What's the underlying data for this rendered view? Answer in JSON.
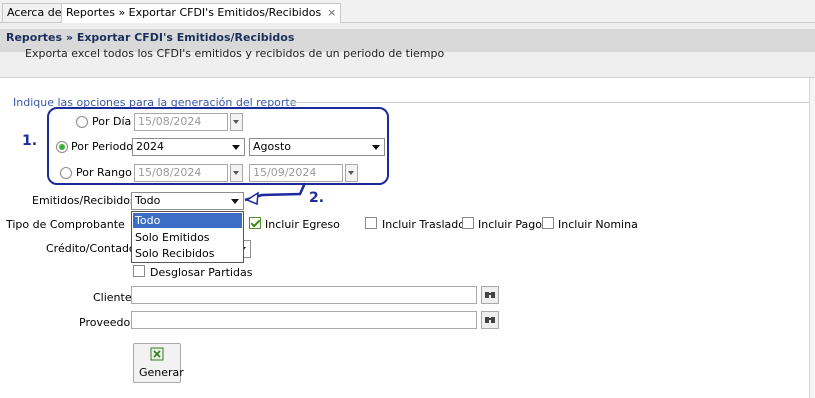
{
  "tabs": [
    {
      "label": "Acerca de"
    },
    {
      "label": "Reportes » Exportar CFDI's Emitidos/Recibidos",
      "close": "×"
    }
  ],
  "header": {
    "title": "Reportes » Exportar CFDI's Emitidos/Recibidos",
    "subtitle": "Exporta excel todos los CFDI's emitidos y recibidos de un periodo de tiempo"
  },
  "options": {
    "legend": "Indique las opciones para la generación del reporte",
    "por_dia": {
      "label": "Por Día",
      "value": "15/08/2024"
    },
    "por_periodo": {
      "label": "Por Periodo",
      "year": "2024",
      "month": "Agosto"
    },
    "por_rango": {
      "label": "Por Rango",
      "from": "15/08/2024",
      "to": "15/09/2024"
    },
    "selected": "Por Periodo",
    "emitidos_recibidos": {
      "label": "Emitidos/Recibidos",
      "value": "Todo",
      "options": [
        "Todo",
        "Solo Emitidos",
        "Solo Recibidos"
      ]
    },
    "tipo_comprobante": {
      "label": "Tipo de Comprobante",
      "checks": [
        {
          "label": "Incluir Egreso",
          "checked": true
        },
        {
          "label": "Incluir Traslado",
          "checked": false
        },
        {
          "label": "Incluir Pago",
          "checked": false
        },
        {
          "label": "Incluir Nomina",
          "checked": false
        }
      ]
    },
    "credito_contado": {
      "label": "Crédito/Contado"
    },
    "desglosar": {
      "label": "Desglosar Partidas",
      "checked": false
    },
    "cliente": {
      "label": "Cliente",
      "value": ""
    },
    "proveedor": {
      "label": "Proveedor",
      "value": ""
    },
    "generar": {
      "label": "Generar"
    }
  },
  "annotations": {
    "one": "1.",
    "two": "2."
  },
  "colors": {
    "annotation": "#1d2a9a",
    "legend": "#3a57a8",
    "selected_option": "#3c6ec6",
    "radio_on": "#3fae3a"
  }
}
